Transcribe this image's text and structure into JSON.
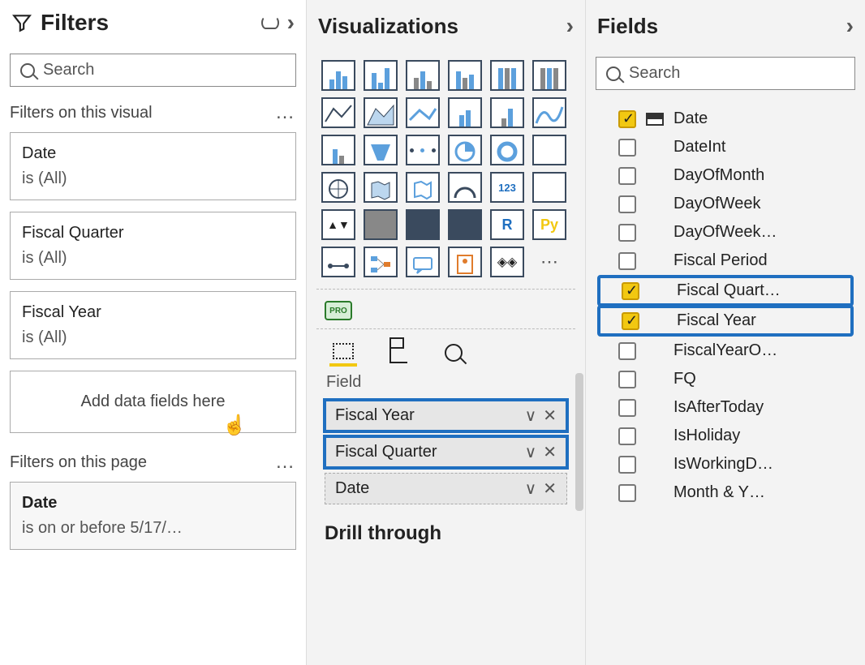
{
  "filters": {
    "title": "Filters",
    "search_placeholder": "Search",
    "sections": {
      "visual": {
        "title": "Filters on this visual"
      },
      "page": {
        "title": "Filters on this page"
      }
    },
    "cards": {
      "date": {
        "name": "Date",
        "cond": "is (All)"
      },
      "fq": {
        "name": "Fiscal Quarter",
        "cond": "is (All)"
      },
      "fy": {
        "name": "Fiscal Year",
        "cond": "is (All)"
      },
      "page_date": {
        "name": "Date",
        "cond": "is on or before 5/17/…"
      }
    },
    "dropzone": "Add data fields here"
  },
  "viz": {
    "title": "Visualizations",
    "pro_label": "PRO",
    "r_label": "R",
    "py_label": "Py",
    "wells": {
      "label": "Field"
    },
    "field_items": {
      "fy": "Fiscal Year",
      "fq": "Fiscal Quarter",
      "date": "Date"
    },
    "drill_label": "Drill through"
  },
  "fields": {
    "title": "Fields",
    "search_placeholder": "Search",
    "items": {
      "date": {
        "label": "Date",
        "checked": true,
        "istable": true
      },
      "dateint": {
        "label": "DateInt",
        "checked": false
      },
      "dayofmonth": {
        "label": "DayOfMonth",
        "checked": false
      },
      "dayofweek": {
        "label": "DayOfWeek",
        "checked": false
      },
      "dayofweekn": {
        "label": "DayOfWeek…",
        "checked": false
      },
      "fiscalperiod": {
        "label": "Fiscal Period",
        "checked": false
      },
      "fiscalquart": {
        "label": "Fiscal Quart…",
        "checked": true
      },
      "fiscalyear": {
        "label": "Fiscal Year",
        "checked": true
      },
      "fiscalyearo": {
        "label": "FiscalYearO…",
        "checked": false
      },
      "fq": {
        "label": "FQ",
        "checked": false
      },
      "isaftertoday": {
        "label": "IsAfterToday",
        "checked": false
      },
      "isholiday": {
        "label": "IsHoliday",
        "checked": false
      },
      "isworkingd": {
        "label": "IsWorkingD…",
        "checked": false
      },
      "monthy": {
        "label": "Month & Y…",
        "checked": false
      }
    }
  }
}
